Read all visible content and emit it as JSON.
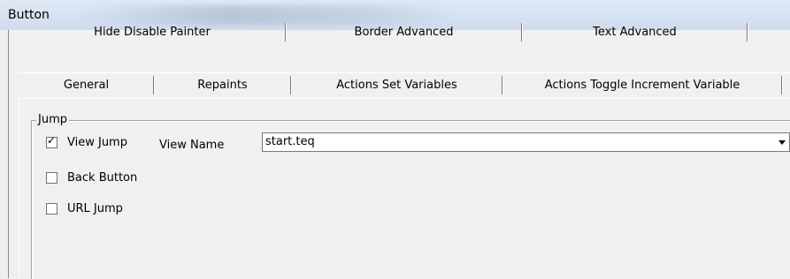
{
  "window": {
    "title": "Button"
  },
  "tabs_back": [
    "Hide Disable Painter",
    "Border Advanced",
    "Text Advanced"
  ],
  "tabs_front": [
    "General",
    "Repaints",
    "Actions Set Variables",
    "Actions Toggle Increment Variable"
  ],
  "group": {
    "label": "Jump",
    "view_jump": {
      "label": "View Jump",
      "checked": true
    },
    "view_name": {
      "label": "View Name",
      "value": "start.teq"
    },
    "back_button": {
      "label": "Back Button",
      "checked": false
    },
    "url_jump": {
      "label": "URL Jump",
      "checked": false
    }
  }
}
